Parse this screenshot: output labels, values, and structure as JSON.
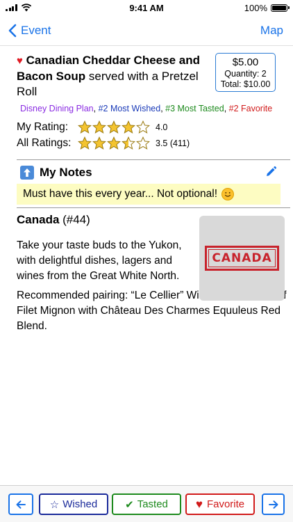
{
  "status_bar": {
    "time": "9:41 AM",
    "battery_text": "100%",
    "battery_level": 1.0
  },
  "nav": {
    "back_label": "Event",
    "right_label": "Map"
  },
  "item": {
    "name_bold": "Canadian Cheddar Cheese and Bacon Soup",
    "name_rest": " served with a Pretzel Roll",
    "price": "$5.00",
    "quantity": "Quantity: 2",
    "total": "Total: $10.00"
  },
  "tags": {
    "plan": "Disney Dining Plan",
    "sep1": ", ",
    "wished": "#2 Most Wished",
    "sep2": ", ",
    "tasted": "#3 Most Tasted",
    "sep3": ", ",
    "favorite": "#2 Favorite"
  },
  "ratings": {
    "my_label": "My Rating:",
    "my_value": "4.0",
    "my_stars": 4.0,
    "all_label": "All Ratings:",
    "all_value": "3.5 (411)",
    "all_stars": 3.5
  },
  "notes": {
    "header": "My Notes",
    "text": "Must have this every year...  Not optional!"
  },
  "location": {
    "name": "Canada",
    "rank": " (#44)",
    "description": "Take your taste buds to the Yukon, with delightful dishes, lagers and wines from the Great White North.",
    "pairing": "Recommended pairing: “Le Cellier” Wild Mushroom Beef Filet Mignon with Château Des Charmes Equuleus Red Blend.",
    "stamp_text": "CANADA"
  },
  "toolbar": {
    "wished_label": "Wished",
    "tasted_label": "Tasted",
    "favorite_label": "Favorite"
  },
  "colors": {
    "accent": "#1a73e8",
    "star_fill": "#f4c430",
    "star_stroke": "#9a7a10",
    "heart": "#d11a1a",
    "tasted": "#1d8a1d"
  }
}
